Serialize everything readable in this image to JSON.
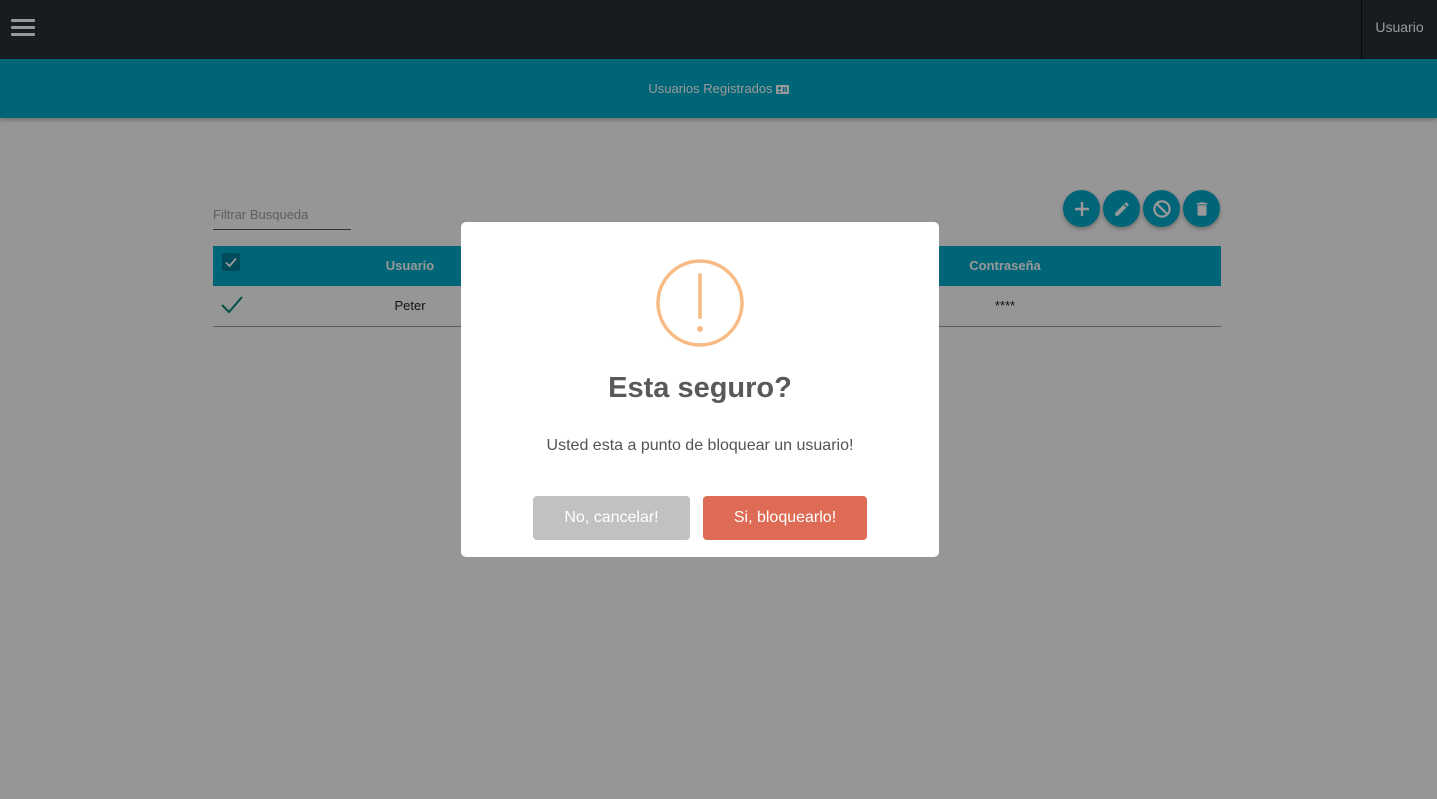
{
  "topbar": {
    "menu_icon": "hamburger-menu-icon",
    "user_label": "Usuario"
  },
  "titlebar": {
    "title": "Usuarios Registrados",
    "icon": "id-card-icon"
  },
  "filter": {
    "placeholder": "Filtrar Busqueda",
    "value": ""
  },
  "actions": {
    "add_icon": "plus-icon",
    "edit_icon": "pencil-icon",
    "block_icon": "block-icon",
    "delete_icon": "trash-icon"
  },
  "table": {
    "columns": [
      "",
      "Usuario",
      "Contraseña"
    ],
    "rows": [
      {
        "selected": true,
        "usuario": "Peter",
        "contrasena": "****"
      }
    ]
  },
  "modal": {
    "icon": "warning-icon",
    "title": "Esta seguro?",
    "text": "Usted esta a punto de bloquear un usuario!",
    "cancel_label": "No, cancelar!",
    "confirm_label": "Si, bloquearlo!"
  },
  "colors": {
    "navbar": "#2a3035",
    "accent": "#00a8c6",
    "warning": "#f8bb86",
    "cancel": "#c1c1c1",
    "confirm": "#dd6b55"
  }
}
